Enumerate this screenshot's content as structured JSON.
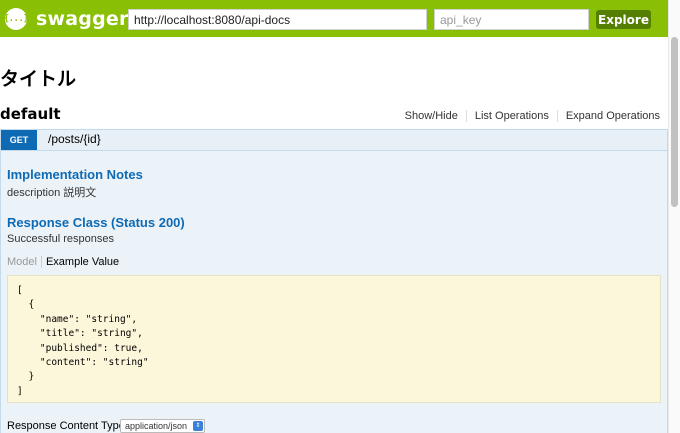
{
  "header": {
    "logo_icon_text": "{...}",
    "logo_text": "swagger",
    "url_value": "http://localhost:8080/api-docs",
    "api_key_placeholder": "api_key",
    "explore_label": "Explore"
  },
  "page": {
    "title": "タイトル"
  },
  "resource": {
    "name": "default",
    "links": [
      "Show/Hide",
      "List Operations",
      "Expand Operations"
    ]
  },
  "operation": {
    "method": "GET",
    "path": "/posts/{id}",
    "implementation_notes_title": "Implementation Notes",
    "implementation_notes_text": "description 説明文",
    "response_class_title": "Response Class (Status 200)",
    "response_class_text": "Successful responses",
    "tabs": [
      "Model",
      "Example Value"
    ],
    "example_value": "[\n  {\n    \"name\": \"string\",\n    \"title\": \"string\",\n    \"published\": true,\n    \"content\": \"string\"\n  }\n]",
    "content_type_label": "Response Content Type",
    "content_type_value": "application/json"
  },
  "colors": {
    "header_bg": "#89bf04",
    "explore_bg": "#547f00",
    "get_badge": "#0f6ab4",
    "op_bg": "#ebf3f9",
    "example_bg": "#fcf6db"
  }
}
